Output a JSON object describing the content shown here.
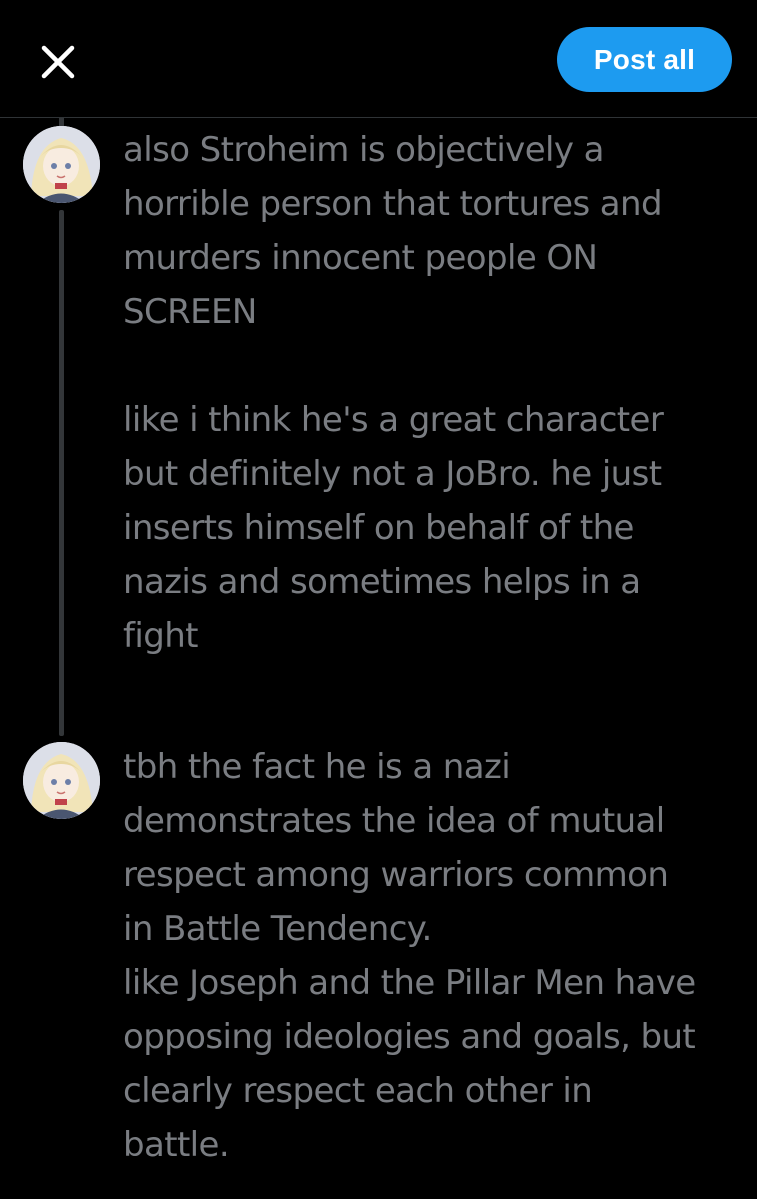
{
  "header": {
    "post_all_label": "Post all",
    "accent_color": "#1d9bf0"
  },
  "posts": [
    {
      "text": "also Stroheim is objectively a\nhorrible person that tortures and\nmurders innocent people ON\nSCREEN\n\nlike i think he's a great character\nbut definitely not a JoBro. he just\ninserts himself on behalf of the\nnazis and sometimes helps in a\nfight"
    },
    {
      "text": "tbh the fact he is a nazi\ndemonstrates the idea of mutual\nrespect among warriors common\nin Battle Tendency.\nlike Joseph and the Pillar Men have\nopposing ideologies and goals, but\nclearly respect each other in\nbattle."
    }
  ],
  "icons": {
    "close": "close-icon",
    "avatar": "avatar-image"
  }
}
